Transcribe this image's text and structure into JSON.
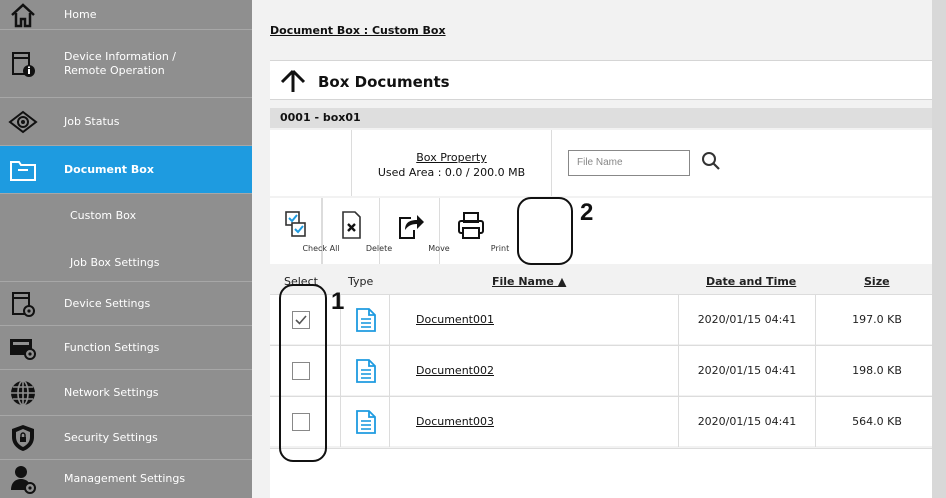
{
  "sidebar": {
    "items": [
      {
        "label": "Home",
        "icon": "home-icon"
      },
      {
        "label_line1": "Device Information /",
        "label_line2": "Remote Operation",
        "icon": "device-info-icon"
      },
      {
        "label": "Job Status",
        "icon": "eye-icon"
      },
      {
        "label": "Document Box",
        "icon": "folder-icon",
        "active": true
      },
      {
        "label": "Custom Box"
      },
      {
        "label": "Job Box Settings"
      },
      {
        "label": "Device Settings",
        "icon": "device-settings-icon"
      },
      {
        "label": "Function Settings",
        "icon": "function-settings-icon"
      },
      {
        "label": "Network Settings",
        "icon": "globe-icon"
      },
      {
        "label": "Security Settings",
        "icon": "shield-icon"
      },
      {
        "label": "Management Settings",
        "icon": "user-gear-icon"
      }
    ]
  },
  "main": {
    "breadcrumb": "Document Box : Custom Box",
    "title": "Box Documents",
    "box_id": "0001 - box01",
    "box_property_link": "Box Property",
    "used_area": "Used Area : 0.0 / 200.0 MB",
    "search_placeholder": "File Name",
    "toolbar": {
      "check_all": "Check All",
      "delete": "Delete",
      "move": "Move",
      "print": "Print"
    },
    "columns": {
      "select": "Select",
      "type": "Type",
      "file_name": "File Name ▲",
      "date_time": "Date and Time",
      "size": "Size"
    },
    "rows": [
      {
        "name": "Document001",
        "date": "2020/01/15 04:41",
        "size": "197.0 KB",
        "checked": true
      },
      {
        "name": "Document002",
        "date": "2020/01/15 04:41",
        "size": "198.0 KB",
        "checked": false
      },
      {
        "name": "Document003",
        "date": "2020/01/15 04:41",
        "size": "564.0 KB",
        "checked": false
      }
    ]
  },
  "annotations": {
    "callout_1": "1",
    "callout_2": "2"
  },
  "colors": {
    "sidebar_bg": "#8f8f8f",
    "active": "#1e9be0",
    "doc_icon": "#1e9be0"
  }
}
